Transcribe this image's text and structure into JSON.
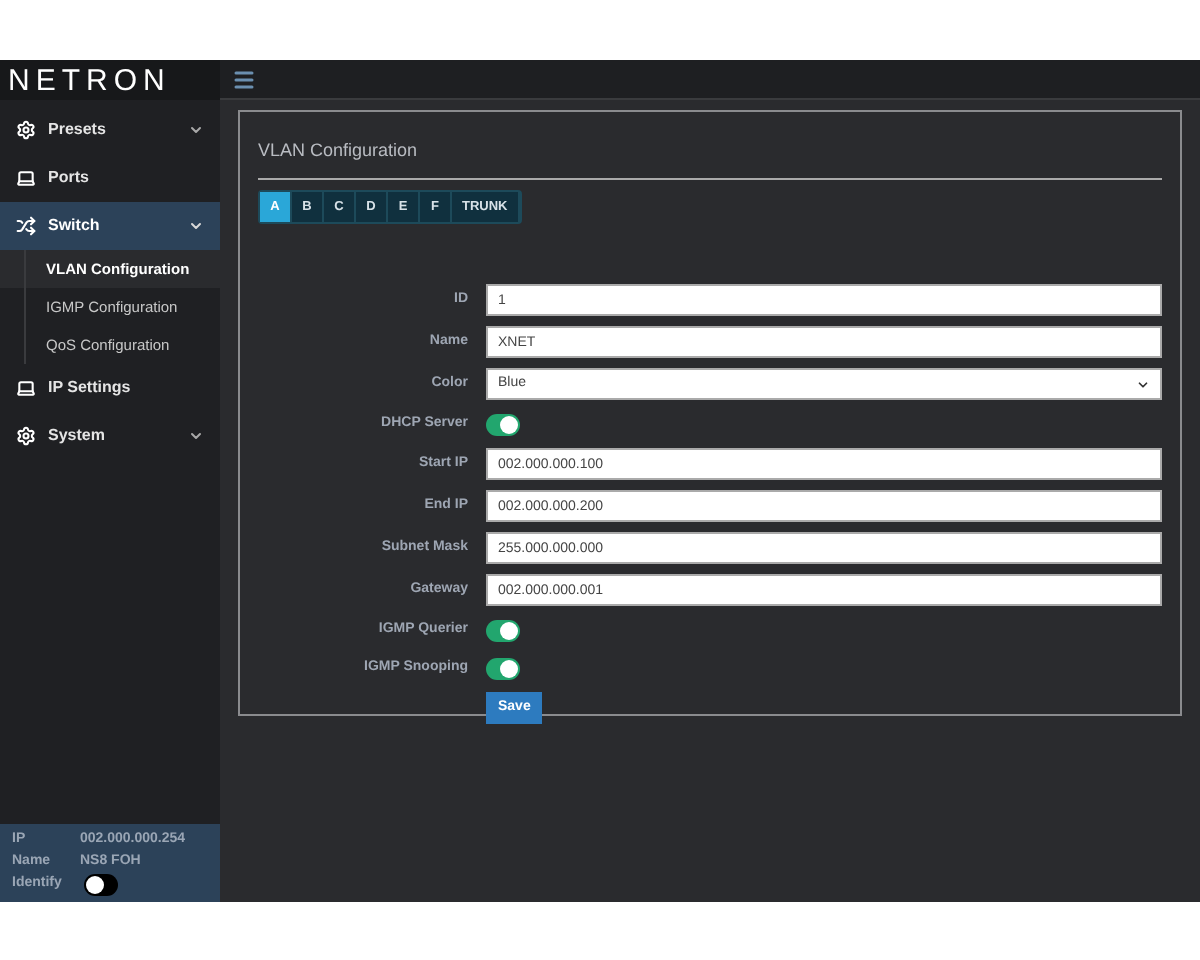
{
  "logo": "NETRON",
  "sidebar": {
    "items": [
      {
        "label": "Presets",
        "kind": "gear",
        "expanded": false,
        "selected": false
      },
      {
        "label": "Ports",
        "kind": "laptop",
        "selected": false
      },
      {
        "label": "Switch",
        "kind": "shuffle",
        "expanded": true,
        "selected": true,
        "children": [
          {
            "label": "VLAN Configuration",
            "selected": true
          },
          {
            "label": "IGMP Configuration",
            "selected": false
          },
          {
            "label": "QoS Configuration",
            "selected": false
          }
        ]
      },
      {
        "label": "IP Settings",
        "kind": "laptop",
        "selected": false
      },
      {
        "label": "System",
        "kind": "gear",
        "expanded": false,
        "selected": false
      }
    ]
  },
  "device_info": {
    "rows": [
      {
        "label": "IP",
        "value": "002.000.000.254"
      },
      {
        "label": "Name",
        "value": "NS8 FOH"
      }
    ],
    "identify": {
      "label": "Identify",
      "on": false
    }
  },
  "panel": {
    "title": "VLAN Configuration",
    "tabs": [
      {
        "label": "A",
        "selected": true
      },
      {
        "label": "B",
        "selected": false
      },
      {
        "label": "C",
        "selected": false
      },
      {
        "label": "D",
        "selected": false
      },
      {
        "label": "E",
        "selected": false
      },
      {
        "label": "F",
        "selected": false
      },
      {
        "label": "TRUNK",
        "selected": false
      }
    ],
    "fields": [
      {
        "kind": "text",
        "label": "ID",
        "value": "1"
      },
      {
        "kind": "text",
        "label": "Name",
        "value": "XNET"
      },
      {
        "kind": "select",
        "label": "Color",
        "value": "Blue"
      },
      {
        "kind": "toggle",
        "label": "DHCP Server",
        "on": true
      },
      {
        "kind": "text",
        "label": "Start IP",
        "value": "002.000.000.100"
      },
      {
        "kind": "text",
        "label": "End IP",
        "value": "002.000.000.200"
      },
      {
        "kind": "text",
        "label": "Subnet Mask",
        "value": "255.000.000.000"
      },
      {
        "kind": "text",
        "label": "Gateway",
        "value": "002.000.000.001"
      },
      {
        "kind": "toggle",
        "label": "IGMP Querier",
        "on": true
      },
      {
        "kind": "toggle",
        "label": "IGMP Snooping",
        "on": true
      }
    ],
    "save_button": "Save"
  }
}
